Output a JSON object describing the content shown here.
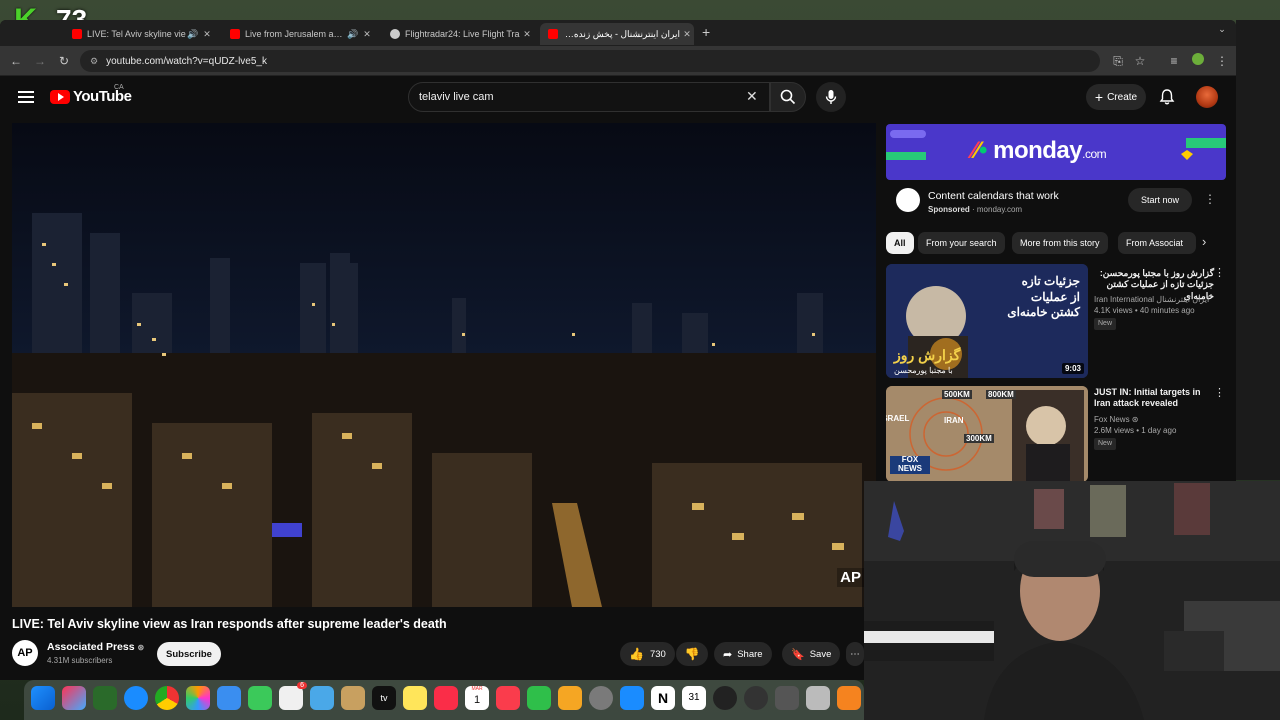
{
  "overlay": {
    "logo": "K",
    "counter": "73"
  },
  "browser": {
    "tabs": [
      {
        "title": "LIVE: Tel Aviv skyline vie",
        "favicon_color": "#ff0000"
      },
      {
        "title": "Live from Jerusalem as sir",
        "favicon_color": "#ff0000"
      },
      {
        "title": "Flightradar24: Live Flight Tra",
        "favicon_color": "#cccccc"
      },
      {
        "title": "ایران اینترنشنال - پخش زنده - ube",
        "favicon_color": "#ff0000"
      }
    ],
    "new_tab": "+",
    "url": "youtube.com/watch?v=qUDZ-lve5_k"
  },
  "youtube": {
    "logo_text": "YouTube",
    "region": "CA",
    "search_value": "telaviv live cam",
    "create_label": "Create",
    "video": {
      "title": "LIVE: Tel Aviv skyline view as Iran responds after supreme leader's death",
      "watermark": "AP",
      "channel_initials": "AP",
      "channel_name": "Associated Press",
      "channel_subs": "4.31M subscribers",
      "subscribe_label": "Subscribe",
      "likes": "730",
      "share_label": "Share",
      "save_label": "Save"
    },
    "ad": {
      "brand": "monday",
      "brand_suffix": ".com",
      "title": "Content calendars that work",
      "sponsored": "Sponsored",
      "domain": "monday.com",
      "cta": "Start now"
    },
    "chips": [
      "All",
      "From your search",
      "More from this story",
      "From Associat"
    ],
    "recommendations": [
      {
        "title": "گزارش روز با مجتبا پورمحسن: جزئیات تازه از عملیات کشتن خامنه‌ای",
        "channel": "Iran International ایران اینترنشنال",
        "meta": "4.1K views • 40 minutes ago",
        "badge": "New",
        "duration": "9:03",
        "thumb_text_1": "جزئیات تازه",
        "thumb_text_2": "از عملیات",
        "thumb_text_3": "کشتن خامنه‌ای",
        "thumb_text_4": "گزارش روز",
        "thumb_text_5": "با مجتبا پورمحسن"
      },
      {
        "title": "JUST IN: Initial targets in Iran attack revealed",
        "channel": "Fox News",
        "meta": "2.6M views • 1 day ago",
        "badge": "New",
        "thumb_text_1": "500KM",
        "thumb_text_2": "800KM",
        "thumb_text_3": "IRAN",
        "thumb_text_4": "300KM",
        "thumb_text_5": "ISRAEL",
        "thumb_text_6": "FOX NEWS"
      }
    ]
  },
  "dock": {
    "calendar_month": "MAR",
    "calendar_day": "1",
    "badge_count": "6"
  }
}
